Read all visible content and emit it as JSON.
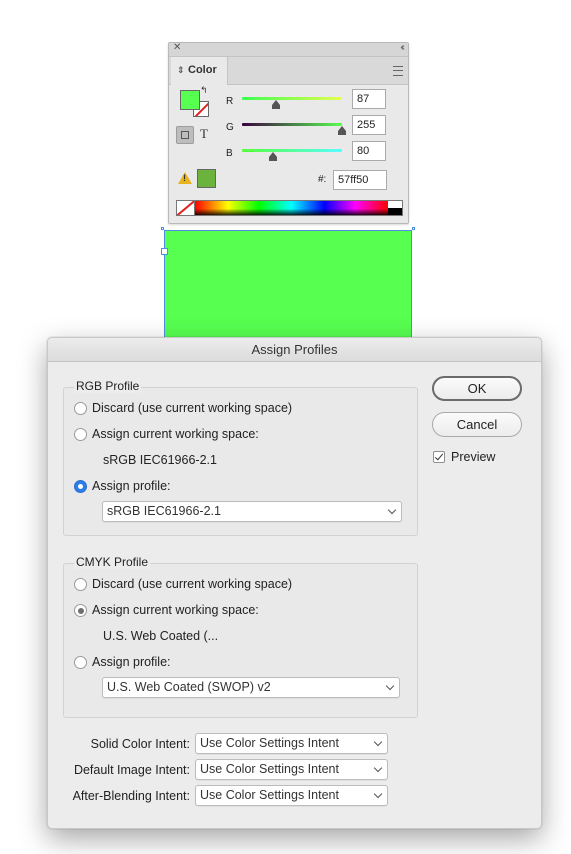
{
  "color_panel": {
    "close_icon": "close-icon",
    "collapse_icon": "double-chevron-left-icon",
    "tab_label": "Color",
    "menu_icon": "panel-menu-icon",
    "fill_color": "#57ff50",
    "sliders": [
      {
        "label": "R",
        "value": "87",
        "level": 0.34,
        "gradient": [
          "#3bff50",
          "#e6ff50"
        ]
      },
      {
        "label": "G",
        "value": "255",
        "level": 1.0,
        "gradient": [
          "#3a003f",
          "#57ff50"
        ]
      },
      {
        "label": "B",
        "value": "80",
        "level": 0.31,
        "gradient": [
          "#57ff3a",
          "#57ffff"
        ]
      }
    ],
    "hex_label": "#:",
    "hex_value": "57ff50",
    "text_toggle": "T",
    "gamut_swatch_color": "#6cb33e"
  },
  "dialog": {
    "title": "Assign Profiles",
    "rgb": {
      "title": "RGB Profile",
      "discard_label": "Discard (use current working space)",
      "assign_current_label": "Assign current working space:",
      "current_space": "sRGB IEC61966-2.1",
      "assign_profile_label": "Assign profile:",
      "profile_value": "sRGB IEC61966-2.1",
      "selected": "assign_profile"
    },
    "cmyk": {
      "title": "CMYK Profile",
      "discard_label": "Discard (use current working space)",
      "assign_current_label": "Assign current working space:",
      "current_space": "U.S. Web Coated (...",
      "assign_profile_label": "Assign profile:",
      "profile_value": "U.S. Web Coated (SWOP) v2",
      "selected": "assign_current"
    },
    "intents": [
      {
        "label": "Solid Color Intent:",
        "value": "Use Color Settings Intent"
      },
      {
        "label": "Default Image Intent:",
        "value": "Use Color Settings Intent"
      },
      {
        "label": "After-Blending Intent:",
        "value": "Use Color Settings Intent"
      }
    ],
    "ok_label": "OK",
    "cancel_label": "Cancel",
    "preview_label": "Preview",
    "preview_checked": true
  }
}
